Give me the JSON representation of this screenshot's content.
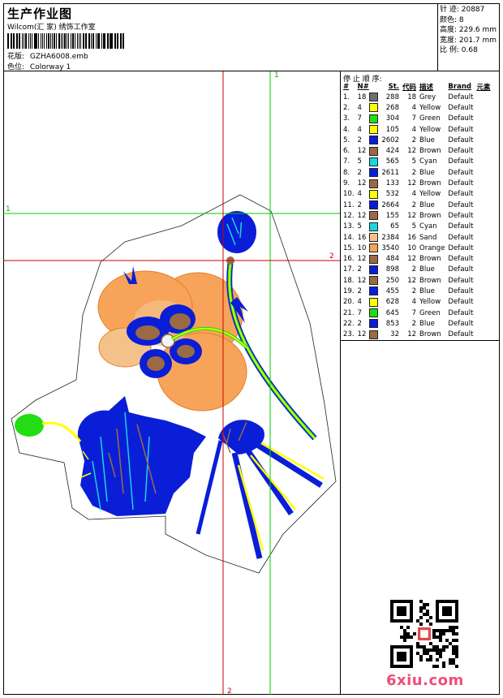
{
  "header": {
    "title": "生产作业图",
    "company": "Wilcom(汇 家) 绣饰工作室",
    "design_label": "花版:",
    "design_value": "GZHA6008.emb",
    "colorway_label": "色位:",
    "colorway_value": "Colorway 1"
  },
  "stats": {
    "stitches": "针 迹: 20887",
    "colors": "颜色: 8",
    "height": "高度: 229.6 mm",
    "width": "宽度: 201.7 mm",
    "ratio": "比 例: 0.68"
  },
  "guides": {
    "green_v": "1",
    "green_h": "1",
    "red_v": "2",
    "red_h": "2"
  },
  "legend": {
    "title": "停 止 顺 序:",
    "headers": [
      "#",
      "N#",
      "St.",
      "代码",
      "描述",
      "Brand",
      "元素"
    ],
    "rows": [
      {
        "n": "1.",
        "c": "18",
        "st": "288",
        "code": "18",
        "desc": "Grey",
        "brand": "Default",
        "color": "#6e6e6e"
      },
      {
        "n": "2.",
        "c": "4",
        "st": "268",
        "code": "4",
        "desc": "Yellow",
        "brand": "Default",
        "color": "#ffff00"
      },
      {
        "n": "3.",
        "c": "7",
        "st": "304",
        "code": "7",
        "desc": "Green",
        "brand": "Default",
        "color": "#22dd11"
      },
      {
        "n": "4.",
        "c": "4",
        "st": "105",
        "code": "4",
        "desc": "Yellow",
        "brand": "Default",
        "color": "#ffff00"
      },
      {
        "n": "5.",
        "c": "2",
        "st": "2602",
        "code": "2",
        "desc": "Blue",
        "brand": "Default",
        "color": "#0a1ed8"
      },
      {
        "n": "6.",
        "c": "12",
        "st": "424",
        "code": "12",
        "desc": "Brown",
        "brand": "Default",
        "color": "#9a6a44"
      },
      {
        "n": "7.",
        "c": "5",
        "st": "565",
        "code": "5",
        "desc": "Cyan",
        "brand": "Default",
        "color": "#19d6dc"
      },
      {
        "n": "8.",
        "c": "2",
        "st": "2611",
        "code": "2",
        "desc": "Blue",
        "brand": "Default",
        "color": "#0a1ed8"
      },
      {
        "n": "9.",
        "c": "12",
        "st": "133",
        "code": "12",
        "desc": "Brown",
        "brand": "Default",
        "color": "#9a6a44"
      },
      {
        "n": "10.",
        "c": "4",
        "st": "532",
        "code": "4",
        "desc": "Yellow",
        "brand": "Default",
        "color": "#ffff00"
      },
      {
        "n": "11.",
        "c": "2",
        "st": "2664",
        "code": "2",
        "desc": "Blue",
        "brand": "Default",
        "color": "#0a1ed8"
      },
      {
        "n": "12.",
        "c": "12",
        "st": "155",
        "code": "12",
        "desc": "Brown",
        "brand": "Default",
        "color": "#9a6a44"
      },
      {
        "n": "13.",
        "c": "5",
        "st": "65",
        "code": "5",
        "desc": "Cyan",
        "brand": "Default",
        "color": "#19d6dc"
      },
      {
        "n": "14.",
        "c": "16",
        "st": "2384",
        "code": "16",
        "desc": "Sand",
        "brand": "Default",
        "color": "#f3c28a"
      },
      {
        "n": "15.",
        "c": "10",
        "st": "3540",
        "code": "10",
        "desc": "Orange",
        "brand": "Default",
        "color": "#f7a35a"
      },
      {
        "n": "16.",
        "c": "12",
        "st": "484",
        "code": "12",
        "desc": "Brown",
        "brand": "Default",
        "color": "#9a6a44"
      },
      {
        "n": "17.",
        "c": "2",
        "st": "898",
        "code": "2",
        "desc": "Blue",
        "brand": "Default",
        "color": "#0a1ed8"
      },
      {
        "n": "18.",
        "c": "12",
        "st": "250",
        "code": "12",
        "desc": "Brown",
        "brand": "Default",
        "color": "#9a6a44"
      },
      {
        "n": "19.",
        "c": "2",
        "st": "455",
        "code": "2",
        "desc": "Blue",
        "brand": "Default",
        "color": "#0a1ed8"
      },
      {
        "n": "20.",
        "c": "4",
        "st": "628",
        "code": "4",
        "desc": "Yellow",
        "brand": "Default",
        "color": "#ffff00"
      },
      {
        "n": "21.",
        "c": "7",
        "st": "645",
        "code": "7",
        "desc": "Green",
        "brand": "Default",
        "color": "#22dd11"
      },
      {
        "n": "22.",
        "c": "2",
        "st": "853",
        "code": "2",
        "desc": "Blue",
        "brand": "Default",
        "color": "#0a1ed8"
      },
      {
        "n": "23.",
        "c": "12",
        "st": "32",
        "code": "12",
        "desc": "Brown",
        "brand": "Default",
        "color": "#9a6a44"
      }
    ]
  },
  "watermark": "6xiu.com",
  "colors": {
    "blue": "#0a1ed8",
    "orange": "#f7a35a",
    "brown": "#9a6a44",
    "yellow": "#ffff00",
    "green": "#22dd11",
    "cyan": "#19d6dc",
    "guide_green": "#00cc00",
    "guide_red": "#cc0000"
  }
}
